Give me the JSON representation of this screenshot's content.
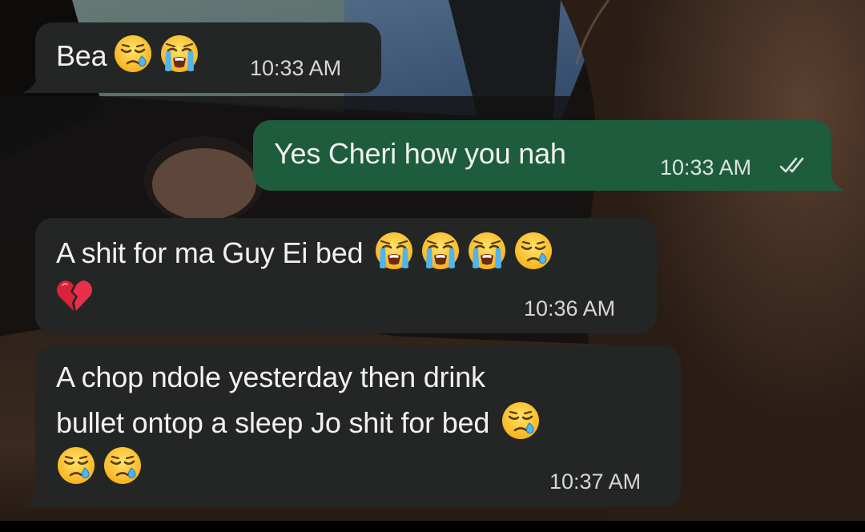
{
  "conversation": {
    "messages": [
      {
        "direction": "incoming",
        "text": "Bea",
        "emojis": [
          "sleepy-face",
          "loudly-crying-face"
        ],
        "time": "10:33 AM"
      },
      {
        "direction": "outgoing",
        "text": "Yes Cheri how you nah",
        "emojis": [],
        "time": "10:33 AM",
        "status": "read-double-check"
      },
      {
        "direction": "incoming",
        "text": "A shit for ma Guy Ei bed",
        "emojis": [
          "loudly-crying-face",
          "loudly-crying-face",
          "loudly-crying-face",
          "sleepy-face",
          "broken-heart"
        ],
        "time": "10:36 AM"
      },
      {
        "direction": "incoming",
        "lines": [
          "A chop ndole yesterday then drink",
          "bullet ontop a sleep Jo shit for bed"
        ],
        "emojis": [
          "sleepy-face",
          "sleepy-face",
          "sleepy-face"
        ],
        "time": "10:37 AM"
      }
    ]
  },
  "colors": {
    "incoming_bubble": "#242626",
    "outgoing_bubble": "#1e5c3e",
    "message_text": "#f1f1f1",
    "read_ticks": "#d7e5dc"
  }
}
